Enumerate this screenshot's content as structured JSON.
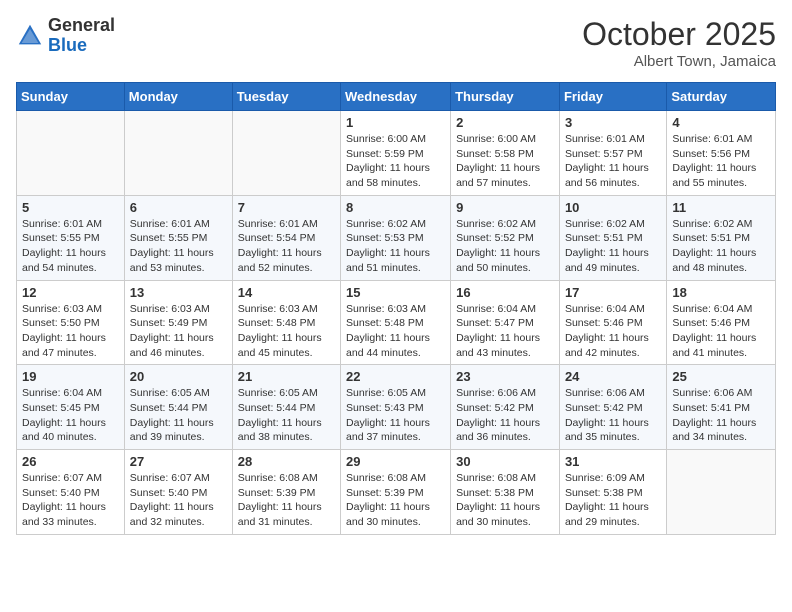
{
  "header": {
    "logo_general": "General",
    "logo_blue": "Blue",
    "month": "October 2025",
    "location": "Albert Town, Jamaica"
  },
  "weekdays": [
    "Sunday",
    "Monday",
    "Tuesday",
    "Wednesday",
    "Thursday",
    "Friday",
    "Saturday"
  ],
  "weeks": [
    [
      {
        "day": "",
        "content": ""
      },
      {
        "day": "",
        "content": ""
      },
      {
        "day": "",
        "content": ""
      },
      {
        "day": "1",
        "content": "Sunrise: 6:00 AM\nSunset: 5:59 PM\nDaylight: 11 hours\nand 58 minutes."
      },
      {
        "day": "2",
        "content": "Sunrise: 6:00 AM\nSunset: 5:58 PM\nDaylight: 11 hours\nand 57 minutes."
      },
      {
        "day": "3",
        "content": "Sunrise: 6:01 AM\nSunset: 5:57 PM\nDaylight: 11 hours\nand 56 minutes."
      },
      {
        "day": "4",
        "content": "Sunrise: 6:01 AM\nSunset: 5:56 PM\nDaylight: 11 hours\nand 55 minutes."
      }
    ],
    [
      {
        "day": "5",
        "content": "Sunrise: 6:01 AM\nSunset: 5:55 PM\nDaylight: 11 hours\nand 54 minutes."
      },
      {
        "day": "6",
        "content": "Sunrise: 6:01 AM\nSunset: 5:55 PM\nDaylight: 11 hours\nand 53 minutes."
      },
      {
        "day": "7",
        "content": "Sunrise: 6:01 AM\nSunset: 5:54 PM\nDaylight: 11 hours\nand 52 minutes."
      },
      {
        "day": "8",
        "content": "Sunrise: 6:02 AM\nSunset: 5:53 PM\nDaylight: 11 hours\nand 51 minutes."
      },
      {
        "day": "9",
        "content": "Sunrise: 6:02 AM\nSunset: 5:52 PM\nDaylight: 11 hours\nand 50 minutes."
      },
      {
        "day": "10",
        "content": "Sunrise: 6:02 AM\nSunset: 5:51 PM\nDaylight: 11 hours\nand 49 minutes."
      },
      {
        "day": "11",
        "content": "Sunrise: 6:02 AM\nSunset: 5:51 PM\nDaylight: 11 hours\nand 48 minutes."
      }
    ],
    [
      {
        "day": "12",
        "content": "Sunrise: 6:03 AM\nSunset: 5:50 PM\nDaylight: 11 hours\nand 47 minutes."
      },
      {
        "day": "13",
        "content": "Sunrise: 6:03 AM\nSunset: 5:49 PM\nDaylight: 11 hours\nand 46 minutes."
      },
      {
        "day": "14",
        "content": "Sunrise: 6:03 AM\nSunset: 5:48 PM\nDaylight: 11 hours\nand 45 minutes."
      },
      {
        "day": "15",
        "content": "Sunrise: 6:03 AM\nSunset: 5:48 PM\nDaylight: 11 hours\nand 44 minutes."
      },
      {
        "day": "16",
        "content": "Sunrise: 6:04 AM\nSunset: 5:47 PM\nDaylight: 11 hours\nand 43 minutes."
      },
      {
        "day": "17",
        "content": "Sunrise: 6:04 AM\nSunset: 5:46 PM\nDaylight: 11 hours\nand 42 minutes."
      },
      {
        "day": "18",
        "content": "Sunrise: 6:04 AM\nSunset: 5:46 PM\nDaylight: 11 hours\nand 41 minutes."
      }
    ],
    [
      {
        "day": "19",
        "content": "Sunrise: 6:04 AM\nSunset: 5:45 PM\nDaylight: 11 hours\nand 40 minutes."
      },
      {
        "day": "20",
        "content": "Sunrise: 6:05 AM\nSunset: 5:44 PM\nDaylight: 11 hours\nand 39 minutes."
      },
      {
        "day": "21",
        "content": "Sunrise: 6:05 AM\nSunset: 5:44 PM\nDaylight: 11 hours\nand 38 minutes."
      },
      {
        "day": "22",
        "content": "Sunrise: 6:05 AM\nSunset: 5:43 PM\nDaylight: 11 hours\nand 37 minutes."
      },
      {
        "day": "23",
        "content": "Sunrise: 6:06 AM\nSunset: 5:42 PM\nDaylight: 11 hours\nand 36 minutes."
      },
      {
        "day": "24",
        "content": "Sunrise: 6:06 AM\nSunset: 5:42 PM\nDaylight: 11 hours\nand 35 minutes."
      },
      {
        "day": "25",
        "content": "Sunrise: 6:06 AM\nSunset: 5:41 PM\nDaylight: 11 hours\nand 34 minutes."
      }
    ],
    [
      {
        "day": "26",
        "content": "Sunrise: 6:07 AM\nSunset: 5:40 PM\nDaylight: 11 hours\nand 33 minutes."
      },
      {
        "day": "27",
        "content": "Sunrise: 6:07 AM\nSunset: 5:40 PM\nDaylight: 11 hours\nand 32 minutes."
      },
      {
        "day": "28",
        "content": "Sunrise: 6:08 AM\nSunset: 5:39 PM\nDaylight: 11 hours\nand 31 minutes."
      },
      {
        "day": "29",
        "content": "Sunrise: 6:08 AM\nSunset: 5:39 PM\nDaylight: 11 hours\nand 30 minutes."
      },
      {
        "day": "30",
        "content": "Sunrise: 6:08 AM\nSunset: 5:38 PM\nDaylight: 11 hours\nand 30 minutes."
      },
      {
        "day": "31",
        "content": "Sunrise: 6:09 AM\nSunset: 5:38 PM\nDaylight: 11 hours\nand 29 minutes."
      },
      {
        "day": "",
        "content": ""
      }
    ]
  ]
}
